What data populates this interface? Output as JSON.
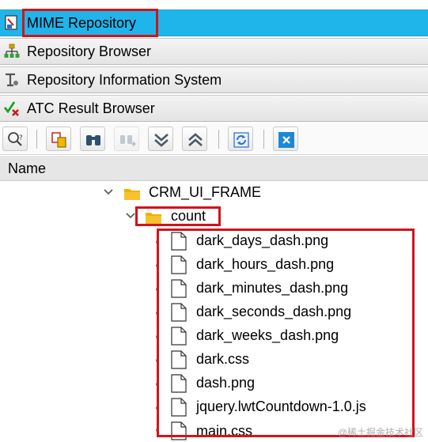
{
  "nav": {
    "items": [
      {
        "label": "MIME Repository"
      },
      {
        "label": "Repository Browser"
      },
      {
        "label": "Repository Information System"
      },
      {
        "label": "ATC Result Browser"
      }
    ]
  },
  "tree": {
    "header": "Name",
    "root_folder": "CRM_UI_FRAME",
    "sub_folder": "count",
    "files": [
      "dark_days_dash.png",
      "dark_hours_dash.png",
      "dark_minutes_dash.png",
      "dark_seconds_dash.png",
      "dark_weeks_dash.png",
      "dark.css",
      "dash.png",
      "jquery.lwtCountdown-1.0.js",
      "main.css"
    ]
  },
  "watermark": "@稀土掘金技术社区",
  "colors": {
    "active_nav": "#1fb5ea",
    "highlight_box": "#d0141c",
    "folder": "#f2b100"
  }
}
